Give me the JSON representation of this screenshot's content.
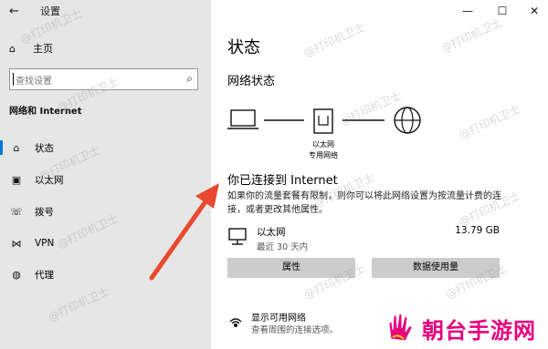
{
  "window": {
    "title": "设置",
    "controls": {
      "minimize": "—",
      "maximize": "☐",
      "close": "✕"
    }
  },
  "sidebar": {
    "home_label": "主页",
    "search_placeholder": "查找设置",
    "section_title": "网络和 Internet",
    "items": [
      {
        "label": "状态",
        "icon": "home-status-icon"
      },
      {
        "label": "以太网",
        "icon": "ethernet-icon"
      },
      {
        "label": "拨号",
        "icon": "dialup-icon"
      },
      {
        "label": "VPN",
        "icon": "vpn-icon"
      },
      {
        "label": "代理",
        "icon": "globe-icon"
      }
    ]
  },
  "main": {
    "title": "状态",
    "network_status_heading": "网络状态",
    "diagram": {
      "router_label_1": "以太网",
      "router_label_2": "专用网络"
    },
    "status_title": "你已连接到 Internet",
    "status_desc": "如果你的流量套餐有限制，则你可以将此网络设置为按流量计费的连接，或者更改其他属性。",
    "connection": {
      "name": "以太网",
      "sub": "最近 30 天内",
      "usage": "13.79 GB"
    },
    "buttons": {
      "properties": "属性",
      "data_usage": "数据使用量"
    },
    "show_networks": {
      "title": "显示可用网络",
      "sub": "查看周围的连接选项。"
    }
  },
  "watermark_text": "@打印机卫士",
  "brand": {
    "text": "朝台手游网"
  },
  "colors": {
    "accent": "#0078d7",
    "brand": "#e6007e",
    "arrow": "#e8492f"
  }
}
